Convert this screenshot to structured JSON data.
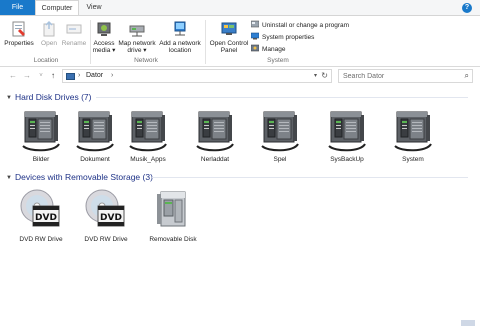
{
  "tabs": {
    "file": "File",
    "computer": "Computer",
    "view": "View",
    "help": "?"
  },
  "ribbon": {
    "location_group": {
      "label": "Location",
      "properties": "Properties",
      "open": "Open",
      "rename": "Rename"
    },
    "network_group": {
      "label": "Network",
      "access_media": [
        "Access",
        "media ▾"
      ],
      "map_network_drive": [
        "Map network",
        "drive ▾"
      ],
      "add_network_location": [
        "Add a network",
        "location"
      ]
    },
    "system_group": {
      "label": "System",
      "open_control_panel": [
        "Open Control",
        "Panel"
      ],
      "uninstall": "Uninstall or change a program",
      "system_properties": "System properties",
      "manage": "Manage"
    }
  },
  "nav": {
    "back": "←",
    "forward": "→",
    "recent": "˅",
    "up": "↑",
    "breadcrumb": "Dator",
    "search_placeholder": "Search Dator"
  },
  "groups": {
    "hard_disks": {
      "title": "Hard Disk Drives (7)",
      "items": [
        "Bilder",
        "Dokument",
        "Musik_Apps",
        "Nerladdat",
        "Spel",
        "SysBackUp",
        "System"
      ]
    },
    "removable": {
      "title": "Devices with Removable Storage (3)",
      "items": [
        {
          "label": "DVD RW Drive",
          "kind": "dvd-icon"
        },
        {
          "label": "DVD RW Drive",
          "kind": "dvd-icon"
        },
        {
          "label": "Removable Disk",
          "kind": "removable-disk-icon"
        }
      ],
      "dvd_badge": "DVD"
    }
  },
  "colors": {
    "accent": "#1979ca",
    "group_title": "#1e3287"
  }
}
